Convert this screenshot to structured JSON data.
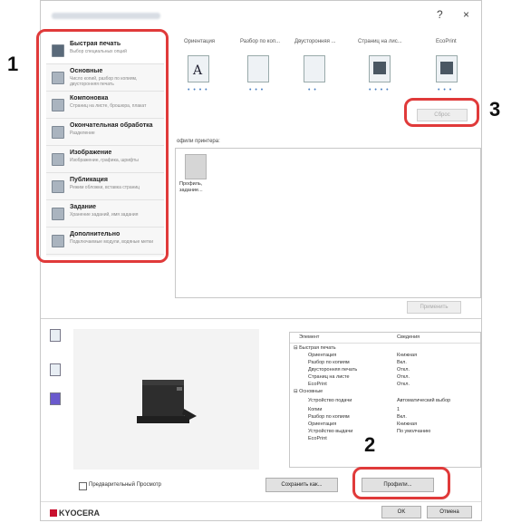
{
  "window": {
    "help_label": "?",
    "close_label": "×"
  },
  "sidebar": {
    "items": [
      {
        "title": "Быстрая печать",
        "subtitle": "Выбор специальных опций"
      },
      {
        "title": "Основные",
        "subtitle": "Число копий, разбор по копиям, двусторонняя печать"
      },
      {
        "title": "Компоновка",
        "subtitle": "Страниц на листе, брошюра, плакат"
      },
      {
        "title": "Окончательная обработка",
        "subtitle": "Разделение"
      },
      {
        "title": "Изображение",
        "subtitle": "Изображение, графика, шрифты"
      },
      {
        "title": "Публикация",
        "subtitle": "Режим обложки, вставка страниц"
      },
      {
        "title": "Задание",
        "subtitle": "Хранение заданий, имя задания"
      },
      {
        "title": "Дополнительно",
        "subtitle": "Подключаемые модули, водяные метки"
      }
    ]
  },
  "quick_tabs": [
    "Ориентация",
    "Разбор по коп...",
    "Двусторонняя ...",
    "Страниц на лис...",
    "EcoPrint"
  ],
  "quick_dots": [
    "• • • •",
    "• • •",
    "• •",
    "• • • •",
    "• • •"
  ],
  "reset_button": "Сброс",
  "profiles": {
    "group_label": "офили принтера:",
    "item_caption": "Профиль, задание...",
    "apply_button": "Применить"
  },
  "summary": {
    "header_element": "Элемент",
    "header_info": "Сведения",
    "rows": [
      {
        "k": "⊟ Быстрая печать",
        "v": ""
      },
      {
        "k": "Ориентация",
        "v": "Книжная"
      },
      {
        "k": "Разбор по копиям",
        "v": "Вкл."
      },
      {
        "k": "Двусторонняя печать",
        "v": "Откл."
      },
      {
        "k": "Страниц на листе",
        "v": "Откл."
      },
      {
        "k": "EcoPrint",
        "v": "Откл."
      },
      {
        "k": "⊟ Основные",
        "v": ""
      },
      {
        "k": "Устройство подачи",
        "v": "Автоматический выбор"
      },
      {
        "k": "Копии",
        "v": "1"
      },
      {
        "k": "Разбор по копиям",
        "v": "Вкл."
      },
      {
        "k": "Ориентация",
        "v": "Книжная"
      },
      {
        "k": "Устройство выдачи",
        "v": "По умолчанию"
      },
      {
        "k": "EcoPrint",
        "v": ""
      }
    ]
  },
  "preview_label": "Предварительный Просмотр",
  "save_as_button": "Сохранить как...",
  "profiles_button": "Профили...",
  "ok_button": "OK",
  "cancel_button": "Отмена",
  "logo_text": "KYOCERA",
  "callouts": {
    "one": "1",
    "two": "2",
    "three": "3"
  },
  "colors": {
    "highlight": "#e03a3a",
    "brand": "#c8102e"
  }
}
